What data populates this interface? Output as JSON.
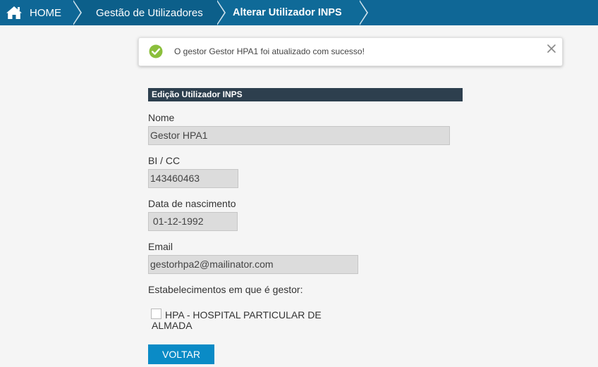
{
  "breadcrumb": {
    "home": "HOME",
    "section": "Gestão de Utilizadores",
    "current": "Alterar Utilizador INPS"
  },
  "notification": {
    "message": "O gestor Gestor HPA1 foi atualizado com sucesso!",
    "icon": "check-circle-icon",
    "icon_color": "#8bbf3c"
  },
  "form": {
    "header": "Edição Utilizador INPS",
    "fields": {
      "nome": {
        "label": "Nome",
        "value": "Gestor HPA1"
      },
      "bi": {
        "label": "BI / CC",
        "value": "143460463"
      },
      "nascimento": {
        "label": "Data de nascimento",
        "value": " 01-12-1992"
      },
      "email": {
        "label": "Email",
        "value": "gestorhpa2@mailinator.com"
      }
    },
    "estabelecimentos_label": "Estabelecimentos em que é gestor:",
    "estabelecimentos": [
      {
        "name": "HPA - HOSPITAL PARTICULAR DE ALMADA",
        "checked": false
      }
    ],
    "back_button": "VOLTAR"
  },
  "colors": {
    "nav_bg": "#0f6796",
    "header_bg": "#2d3f4e",
    "button_bg": "#0a8bc6"
  }
}
